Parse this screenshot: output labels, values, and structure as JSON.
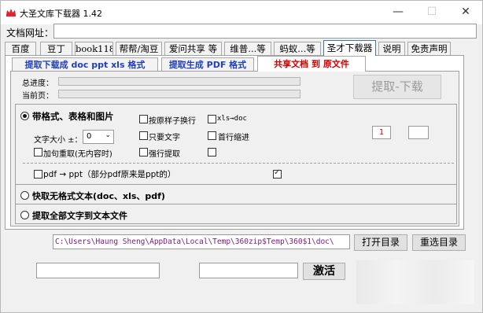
{
  "window": {
    "title": "大圣文库下载器 1.42",
    "min": "—",
    "max": "☐",
    "close": "✕"
  },
  "url_label": "文档网址：",
  "url_value": "",
  "tabs": [
    {
      "label": "百度"
    },
    {
      "label": "豆丁"
    },
    {
      "label": "book118"
    },
    {
      "label": "帮帮/淘豆"
    },
    {
      "label": "爱问共享 等"
    },
    {
      "label": "维普...等"
    },
    {
      "label": "蚂蚁...等"
    },
    {
      "label": "圣才下载器"
    },
    {
      "label": "说明"
    },
    {
      "label": "免责声明"
    }
  ],
  "subtabs": [
    {
      "label": "提取下载成 doc ppt xls 格式"
    },
    {
      "label": "提取生成 PDF 格式"
    },
    {
      "label": "共享文档 到 原文件"
    }
  ],
  "progress": {
    "total_label": "总进度：",
    "current_label": "当前页：",
    "total_fraction": 0,
    "current_fraction": 0
  },
  "extract_button": "提取-下载",
  "options": {
    "radio_format": "带格式、表格和图片",
    "keep_linebreak": "按原样子换行",
    "xls_doc": "xls→doc",
    "font_size_label": "文字大小 ±：",
    "font_size_value": "0",
    "text_only": "只要文字",
    "first_indent": "首行缩进",
    "reload": "加句重取(无内容时)",
    "force_extract": "强行提取",
    "page_from": "1",
    "page_to": "",
    "pdf_ppt": "pdf → ppt（部分pdf原来是ppt的）",
    "radio_plain": "快取无格式文本(doc、xls、pdf)",
    "radio_all_text": "提取全部文字到文本文件"
  },
  "path": "C:\\Users\\Haung Sheng\\AppData\\Local\\Temp\\360zip$Temp\\360$1\\doc\\",
  "open_dir_button": "打开目录",
  "reselect_dir_button": "重选目录",
  "activation_input_1": "",
  "activation_input_2": "",
  "activate_button": "激活"
}
